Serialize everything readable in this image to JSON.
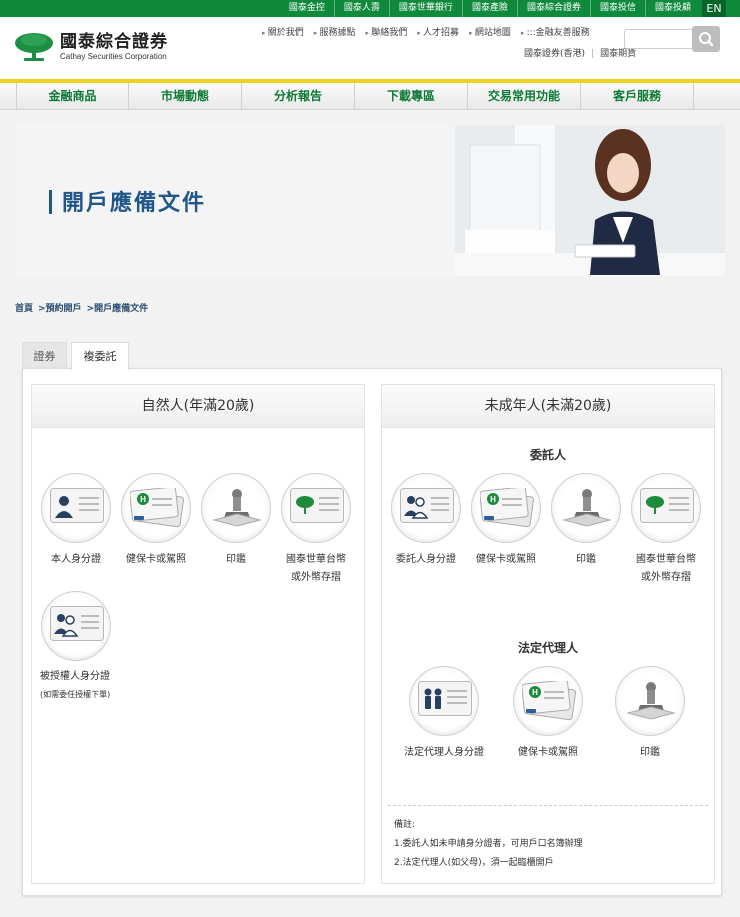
{
  "topbar": {
    "items": [
      "國泰金控",
      "國泰人壽",
      "國泰世華銀行",
      "國泰產險",
      "國泰綜合證券",
      "國泰投信",
      "國泰投顧"
    ],
    "lang": "EN",
    "color": "#0f8a3c"
  },
  "header": {
    "logo_cn": "國泰綜合證券",
    "logo_en": "Cathay Securities Corporation",
    "links": [
      "關於我們",
      "服務據點",
      "聯絡我們",
      "人才招募",
      "網站地圖",
      ":::金融友善服務"
    ],
    "sublinks": [
      "國泰證券(香港)",
      "國泰期貨"
    ],
    "search_placeholder": ""
  },
  "nav": {
    "items": [
      "金融商品",
      "市場動態",
      "分析報告",
      "下載專區",
      "交易常用功能",
      "客戶服務"
    ],
    "color": "#0e7a35"
  },
  "banner": {
    "title": "開戶應備文件"
  },
  "breadcrumb": {
    "home": "首頁",
    "level1": ">預約開戶",
    "level2": ">開戶應備文件"
  },
  "tabs": {
    "tab1": "證券",
    "tab2": "複委託"
  },
  "left": {
    "title": "自然人(年滿20歲)",
    "items": [
      {
        "label": "本人身分證",
        "icon": "id-card-icon"
      },
      {
        "label": "健保卡或駕照",
        "icon": "health-card-icon"
      },
      {
        "label": "印鑑",
        "icon": "seal-stamp-icon"
      },
      {
        "label": "國泰世華台幣",
        "label2": "或外幣存摺",
        "icon": "passbook-icon"
      }
    ],
    "extra": {
      "label": "被授權人身分證",
      "note": "(如需委任授權下單)",
      "icon": "authorized-id-icon"
    }
  },
  "right": {
    "title": "未成年人(未滿20歲)",
    "principal_title": "委託人",
    "principal_items": [
      {
        "label": "委託人身分證",
        "icon": "id-card-icon"
      },
      {
        "label": "健保卡或駕照",
        "icon": "health-card-icon"
      },
      {
        "label": "印鑑",
        "icon": "seal-stamp-icon"
      },
      {
        "label": "國泰世華台幣",
        "label2": "或外幣存摺",
        "icon": "passbook-icon"
      }
    ],
    "guardian_title": "法定代理人",
    "guardian_items": [
      {
        "label": "法定代理人身分證",
        "icon": "guardian-id-icon"
      },
      {
        "label": "健保卡或駕照",
        "icon": "health-card-icon"
      },
      {
        "label": "印鑑",
        "icon": "seal-stamp-icon"
      }
    ],
    "notes": {
      "title": "備註:",
      "line1": "1.委託人如未申請身分證者，可用戶口名簿辦理",
      "line2": "2.法定代理人(如父母)，須一起臨櫃開戶"
    }
  }
}
